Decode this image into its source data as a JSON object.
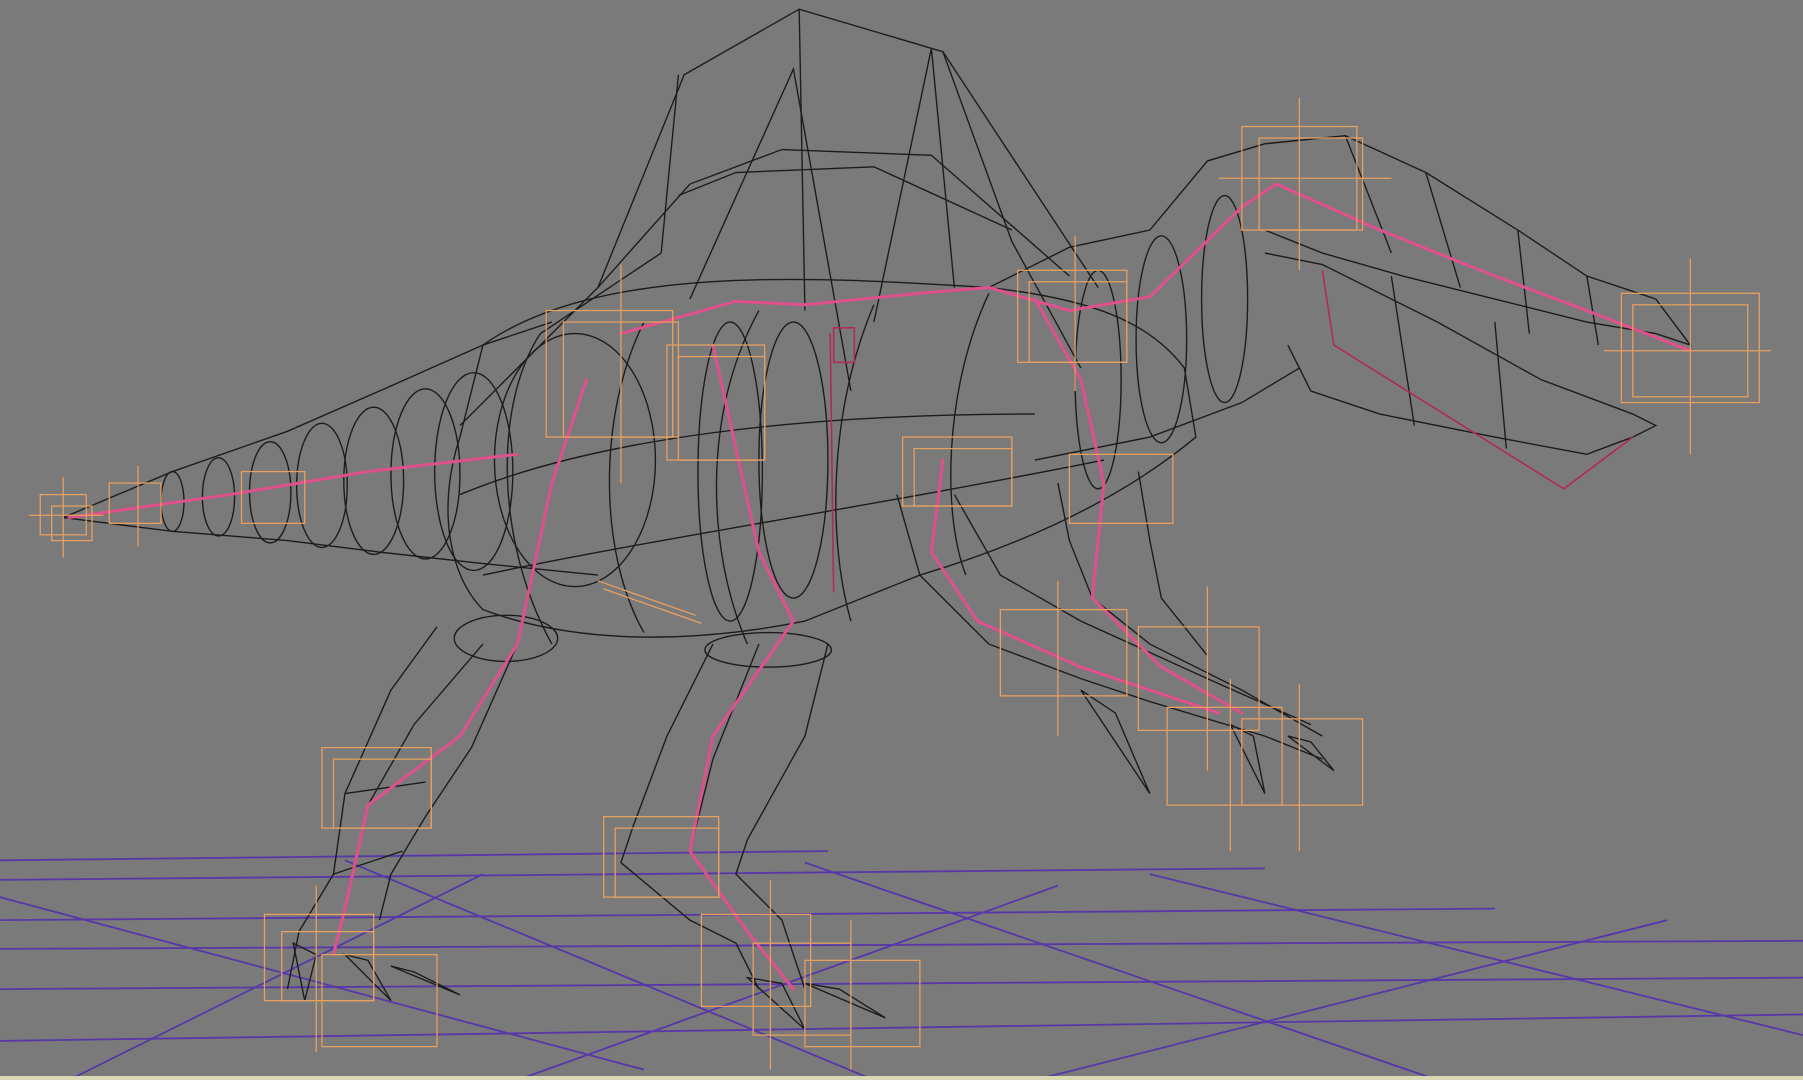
{
  "viewport": {
    "background": "#7a7a7a",
    "view": "3d-wireframe",
    "object": "rigged-dinosaur-model"
  },
  "colors": {
    "mesh": "#1c1c1c",
    "bones": "#e0508c",
    "bones_dark": "#b02a5a",
    "handles": "#e8a060",
    "grid": "#5838a8",
    "footer": "#d8d8b4"
  }
}
